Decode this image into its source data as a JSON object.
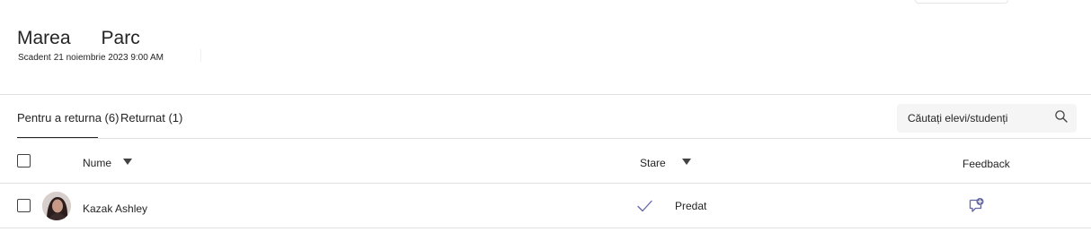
{
  "assignment": {
    "title_part1": "Marea",
    "title_part2": "Parc",
    "due_label": "Scadent",
    "due_date": "21 noiembrie 2023 9:00 AM"
  },
  "tabs": [
    {
      "label": "Pentru a returna (6)",
      "active": true
    },
    {
      "label": "Returnat (1)",
      "active": false
    }
  ],
  "search": {
    "placeholder": "Căutați elevi/studenți",
    "icon": "search-icon"
  },
  "table": {
    "columns": {
      "name": "Nume",
      "status": "Stare",
      "feedback": "Feedback"
    },
    "rows": [
      {
        "name": "Kazak Ashley",
        "status": "Predat",
        "status_icon": "checkmark-icon",
        "feedback_icon": "add-feedback-icon"
      }
    ]
  },
  "colors": {
    "accent": "#6264a7",
    "text": "#242424",
    "divider": "#e1e1e1",
    "search_bg": "#f5f5f5"
  }
}
